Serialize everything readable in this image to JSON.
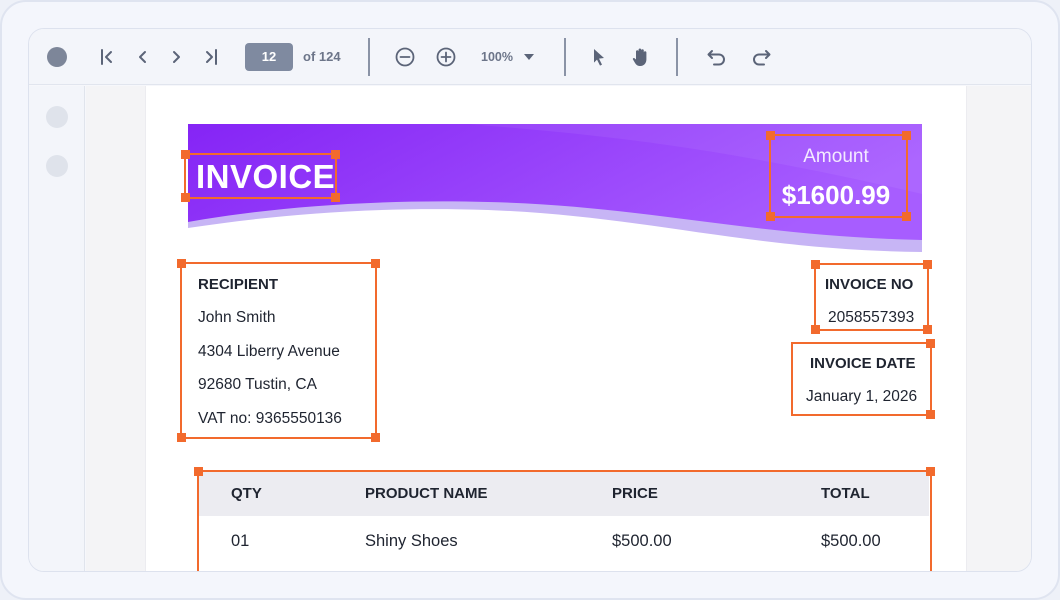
{
  "toolbar": {
    "page_current": "12",
    "page_total_label": "of 124",
    "zoom": "100%",
    "icons": [
      "first-page-icon",
      "prev-page-icon",
      "next-page-icon",
      "last-page-icon",
      "zoom-out-icon",
      "zoom-in-icon",
      "chevron-down-icon",
      "pointer-icon",
      "hand-icon",
      "undo-icon",
      "redo-icon"
    ]
  },
  "invoice": {
    "title": "INVOICE",
    "amount_label": "Amount",
    "amount_value": "$1600.99",
    "recipient": {
      "heading": "RECIPIENT",
      "name": "John Smith",
      "street": "4304 Liberry Avenue",
      "city": "92680 Tustin, CA",
      "vat": "VAT no: 9365550136"
    },
    "invoice_no_label": "INVOICE NO",
    "invoice_no": "2058557393",
    "invoice_date_label": "INVOICE DATE",
    "invoice_date": "January 1, 2026",
    "table": {
      "headers": [
        "QTY",
        "PRODUCT NAME",
        "PRICE",
        "TOTAL"
      ],
      "rows": [
        [
          "01",
          "Shiny Shoes",
          "$500.00",
          "$500.00"
        ]
      ]
    }
  },
  "colors": {
    "accent_orange": "#f26a2d",
    "header_purple": "#8a2cf6",
    "header_purple_light": "#a25bff"
  }
}
